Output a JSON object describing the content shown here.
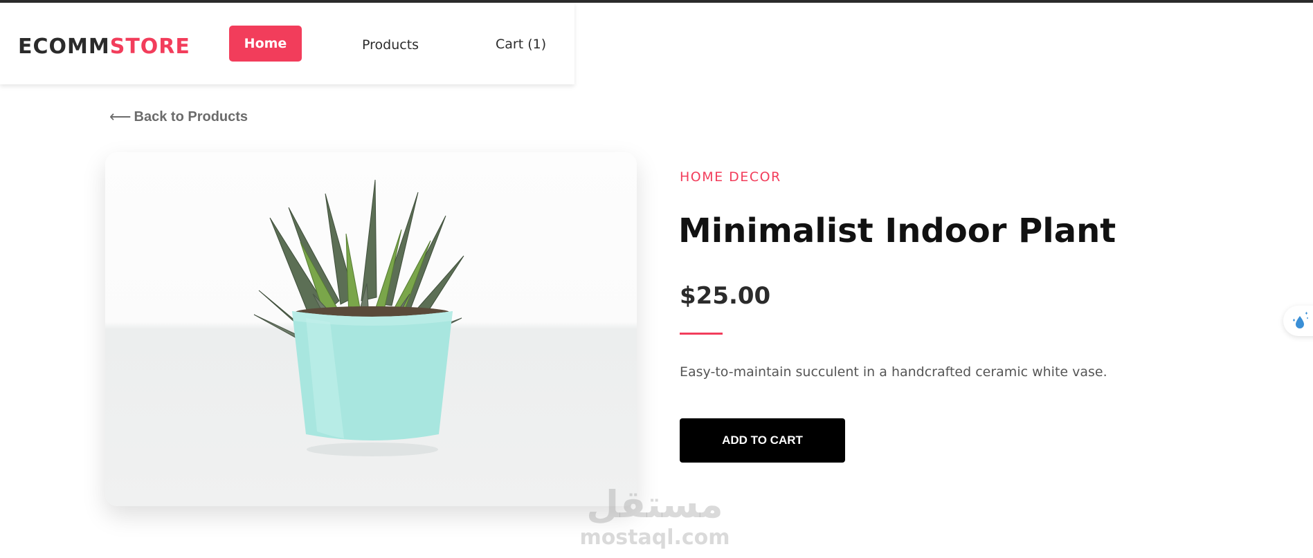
{
  "colors": {
    "accent": "#f23d5b",
    "text_dark": "#2b2b2b",
    "button_black": "#000000"
  },
  "header": {
    "logo": {
      "part1": "ECOMM",
      "part2": "STORE"
    },
    "nav": {
      "home": "Home",
      "products": "Products",
      "cart": "Cart (1)"
    }
  },
  "back_link": {
    "arrow": "⟵",
    "label": "Back to Products"
  },
  "product": {
    "image_icon": "potted-plant-image",
    "category": "HOME DECOR",
    "title": "Minimalist Indoor Plant",
    "price": "$25.00",
    "description": "Easy-to-maintain succulent in a handcrafted ceramic white vase.",
    "add_to_cart": "ADD TO CART"
  },
  "watermark": {
    "arabic": "مستقل",
    "latin": "mostaql.com"
  },
  "floating_widget": {
    "icon": "water-drop-sparkle-icon"
  }
}
